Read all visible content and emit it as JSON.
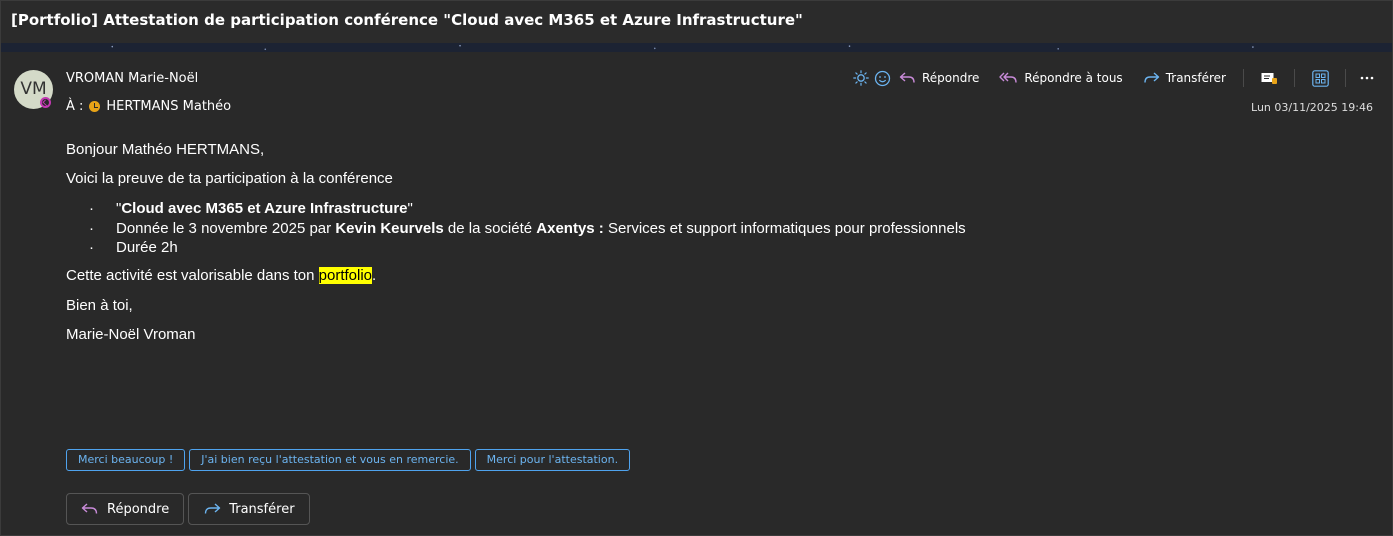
{
  "subject": "[Portfolio] Attestation de participation conférence \"Cloud avec M365 et Azure Infrastructure\"",
  "sender": {
    "initials": "VM",
    "name": "VROMAN Marie-Noël",
    "to_label": "À :",
    "to_name": "HERTMANS Mathéo",
    "date": "Lun 03/11/2025 19:46"
  },
  "toolbar": {
    "reply": "Répondre",
    "reply_all": "Répondre à tous",
    "forward": "Transférer",
    "icons": [
      "brightness-icon",
      "emoji-icon",
      "reply-icon",
      "reply-all-icon",
      "forward-icon",
      "immersive-reader-icon",
      "apps-icon",
      "more-icon"
    ]
  },
  "body": {
    "greeting": "Bonjour Mathéo HERTMANS,",
    "intro": "Voici la preuve de ta participation à la conférence",
    "bullet1": {
      "prefix": "\"",
      "bold": "Cloud avec M365 et Azure Infrastructure",
      "suffix": "\""
    },
    "bullet2": {
      "t1": "Donnée le 3 novembre 2025 par ",
      "b1": "Kevin Keurvels",
      "t2": " de la société ",
      "b2": "Axentys :",
      "t3": " Services et support informatiques pour professionnels"
    },
    "bullet3": "Durée 2h",
    "valorisable": {
      "before": "Cette activité est valorisable dans ton ",
      "highlight": "portfolio",
      "after": "."
    },
    "closing": "Bien à toi,",
    "signature": "Marie-Noël Vroman"
  },
  "suggestions": [
    "Merci beaucoup !",
    "J'ai bien reçu l'attestation et vous en remercie.",
    "Merci pour l'attestation."
  ],
  "actions": {
    "reply": "Répondre",
    "forward": "Transférer"
  },
  "colors": {
    "background": "#292929",
    "accent": "#4fa3ee",
    "reply_icon": "#c98bd9",
    "forward_icon": "#6cb4f0",
    "highlight": "#ffff00"
  }
}
